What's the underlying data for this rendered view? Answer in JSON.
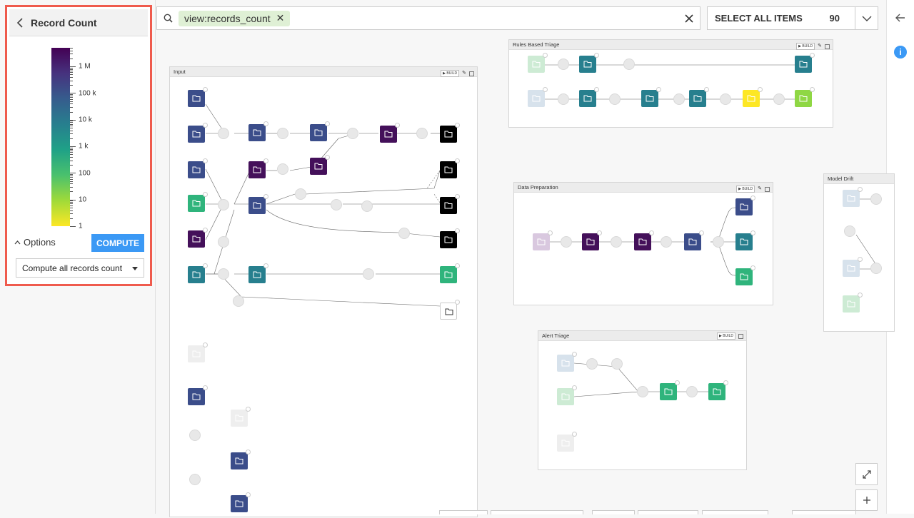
{
  "panel": {
    "title": "Record Count",
    "legend_ticks": [
      "1 M",
      "100 k",
      "10 k",
      "1 k",
      "100",
      "10",
      "1"
    ],
    "options_label": "Options",
    "compute_label": "COMPUTE",
    "compute_mode": "Compute all records count"
  },
  "search": {
    "chip": "view:records_count"
  },
  "select_all": {
    "label": "SELECT ALL ITEMS",
    "count": "90"
  },
  "zones": {
    "input": {
      "title": "Input",
      "build": "▶ BUILD"
    },
    "rules": {
      "title": "Rules Based Triage",
      "build": "▶ BUILD"
    },
    "prep": {
      "title": "Data Preparation",
      "build": "▶ BUILD"
    },
    "alert": {
      "title": "Alert Triage",
      "build": "▶ BUILD"
    },
    "drift": {
      "title": "Model Drift"
    }
  },
  "colors": {
    "accent": "#3b99f5",
    "highlight": "#ef5b4d",
    "chip_bg": "#dff0d5"
  }
}
